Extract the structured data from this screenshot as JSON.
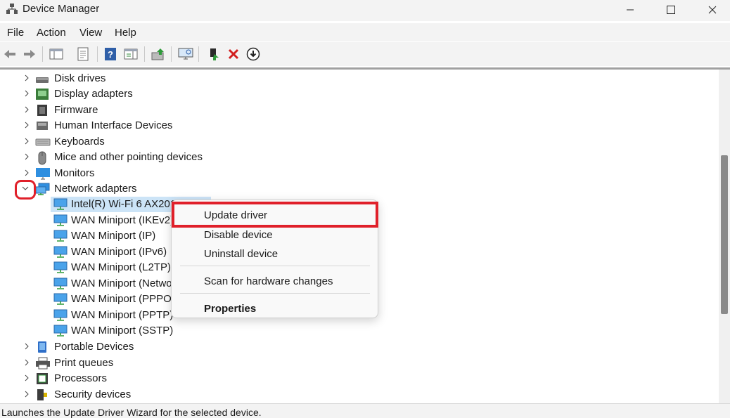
{
  "window": {
    "title": "Device Manager",
    "app_icon": "device-manager-icon"
  },
  "menu": [
    "File",
    "Action",
    "View",
    "Help"
  ],
  "toolbar": {
    "icons": [
      "back-icon",
      "forward-icon",
      "show-hide-tree-icon",
      "properties-icon",
      "help-icon",
      "action-pane-icon",
      "update-driver-icon",
      "scan-hardware-icon",
      "enable-device-icon",
      "uninstall-icon",
      "download-icon"
    ]
  },
  "tree": {
    "categories_top": [
      {
        "label": "Disk drives",
        "icon": "disk-drive-icon"
      },
      {
        "label": "Display adapters",
        "icon": "display-adapter-icon"
      },
      {
        "label": "Firmware",
        "icon": "firmware-icon"
      },
      {
        "label": "Human Interface Devices",
        "icon": "hid-icon"
      },
      {
        "label": "Keyboards",
        "icon": "keyboard-icon"
      },
      {
        "label": "Mice and other pointing devices",
        "icon": "mouse-icon"
      },
      {
        "label": "Monitors",
        "icon": "monitor-icon"
      }
    ],
    "expanded": {
      "label": "Network adapters",
      "icon": "network-adapter-icon",
      "children": [
        "Intel(R) Wi-Fi 6 AX201",
        "WAN Miniport (IKEv2)",
        "WAN Miniport (IP)",
        "WAN Miniport (IPv6)",
        "WAN Miniport (L2TP)",
        "WAN Miniport (Netwo",
        "WAN Miniport (PPPOE",
        "WAN Miniport (PPTP)",
        "WAN Miniport (SSTP)"
      ]
    },
    "categories_bottom": [
      {
        "label": "Portable Devices",
        "icon": "portable-device-icon"
      },
      {
        "label": "Print queues",
        "icon": "printer-icon"
      },
      {
        "label": "Processors",
        "icon": "processor-icon"
      },
      {
        "label": "Security devices",
        "icon": "security-device-icon"
      }
    ]
  },
  "context_menu": {
    "update": "Update driver",
    "disable": "Disable device",
    "uninstall": "Uninstall device",
    "scan": "Scan for hardware changes",
    "properties": "Properties"
  },
  "status": "Launches the Update Driver Wizard for the selected device.",
  "colors": {
    "highlight": "#e0202a",
    "selection": "#cce4f7"
  }
}
